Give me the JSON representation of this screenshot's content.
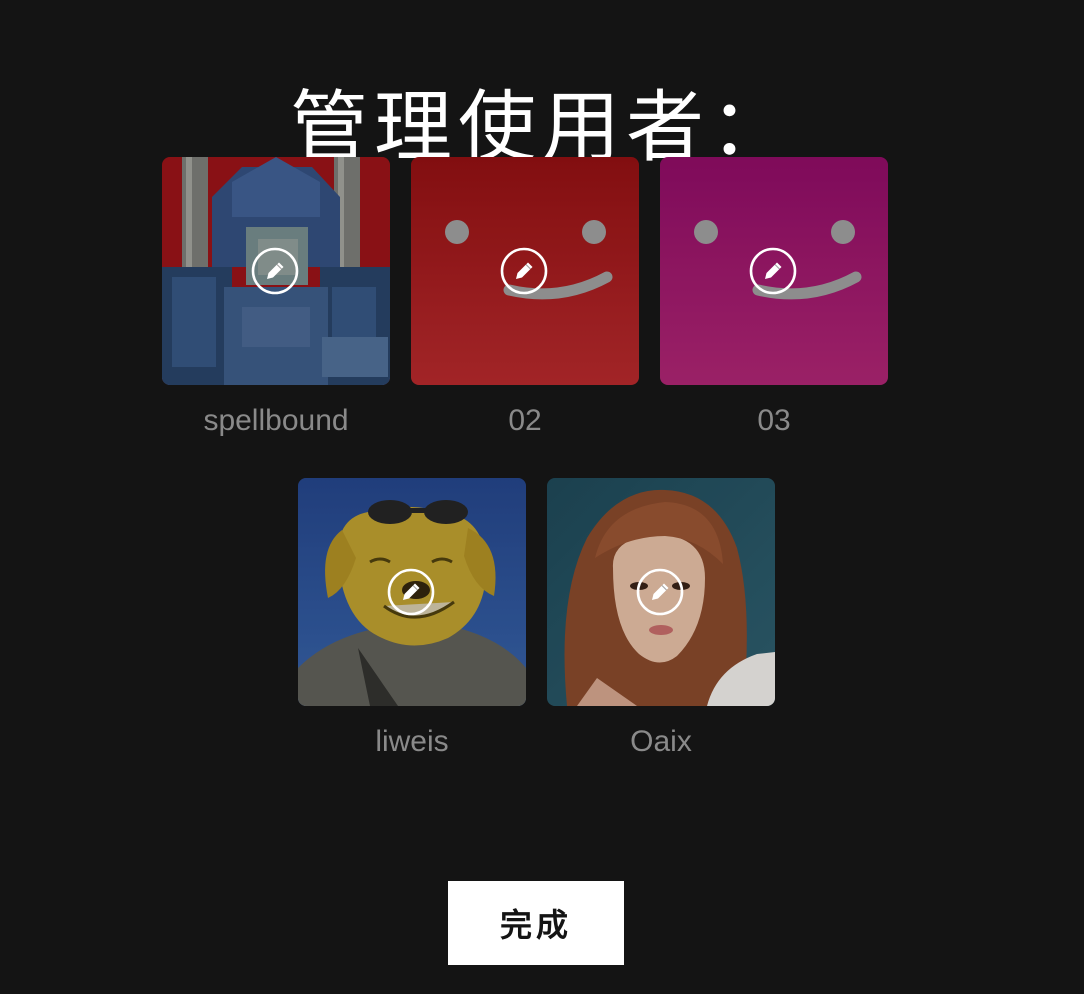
{
  "page": {
    "title": "管理使用者：",
    "background": "#141414"
  },
  "profiles": [
    {
      "name": "spellbound",
      "avatar": "robot-armor-avatar",
      "edit_icon": "pencil-icon"
    },
    {
      "name": "02",
      "avatar": "red-smiley-avatar",
      "color": "#b3171c",
      "edit_icon": "pencil-icon"
    },
    {
      "name": "03",
      "avatar": "magenta-smiley-avatar",
      "color": "#a1146e",
      "edit_icon": "pencil-icon"
    },
    {
      "name": "liweis",
      "avatar": "cartoon-dog-avatar",
      "edit_icon": "pencil-icon"
    },
    {
      "name": "Oaix",
      "avatar": "woman-portrait-avatar",
      "edit_icon": "pencil-icon"
    }
  ],
  "actions": {
    "done_label": "完成"
  }
}
